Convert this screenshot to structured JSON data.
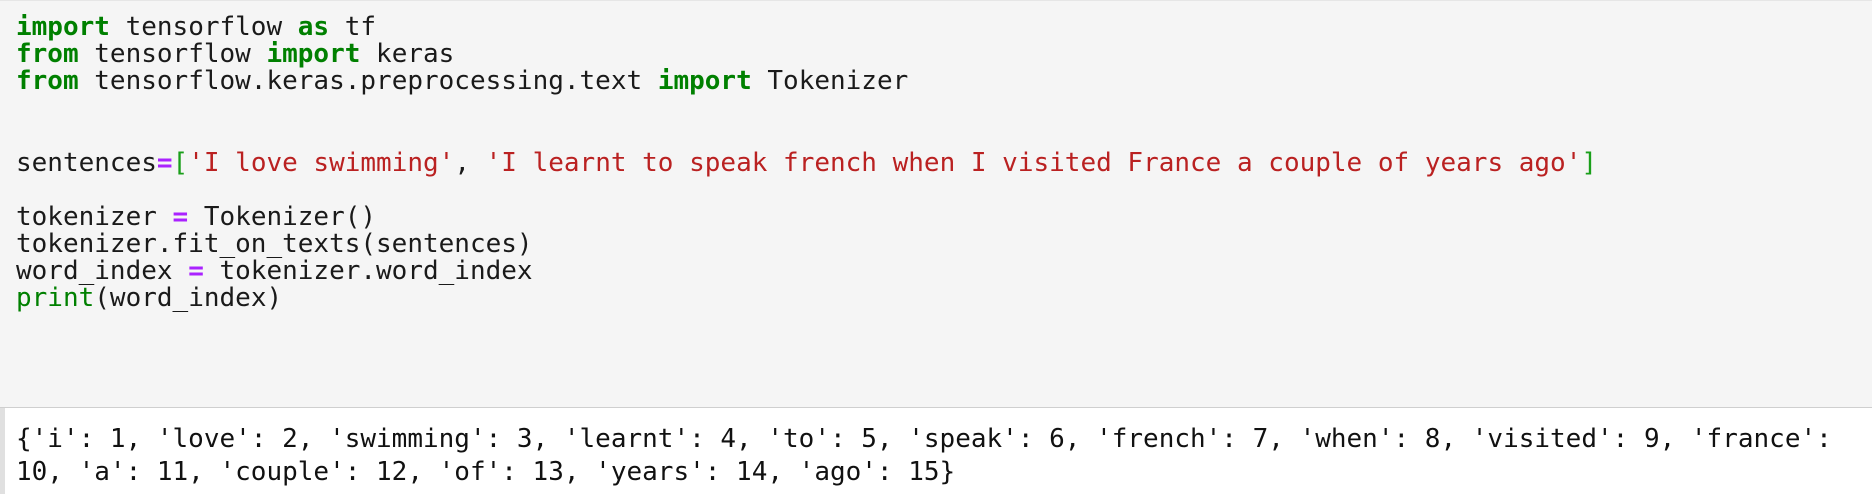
{
  "code_cell": {
    "line1": {
      "kw1": "import",
      "t1": " tensorflow ",
      "kw2": "as",
      "t2": " tf"
    },
    "line2": {
      "kw1": "from",
      "t1": " tensorflow ",
      "kw2": "import",
      "t2": " keras"
    },
    "line3": {
      "kw1": "from",
      "t1": " tensorflow.keras.preprocessing.text ",
      "kw2": "import",
      "t2": " Tokenizer"
    },
    "line6": {
      "var": "sentences",
      "op": "=",
      "open": "[",
      "s1": "'I love swimming'",
      "sep": ", ",
      "s2": "'I learnt to speak french when I visited France a couple of years ago'",
      "close": "]"
    },
    "line8": {
      "var": "tokenizer ",
      "op": "=",
      "rest": " Tokenizer()"
    },
    "line9": {
      "text": "tokenizer.fit_on_texts(sentences)"
    },
    "line10": {
      "var": "word_index ",
      "op": "=",
      "rest": " tokenizer.word_index"
    },
    "line11": {
      "fn": "print",
      "rest": "(word_index)"
    }
  },
  "output": {
    "line1": "{'i': 1, 'love': 2, 'swimming': 3, 'learnt': 4, 'to': 5, 'speak': 6, 'french': 7, 'when': 8, 'visited': 9, 'france':",
    "line2": "10, 'a': 11, 'couple': 12, 'of': 13, 'years': 14, 'ago': 15}"
  }
}
